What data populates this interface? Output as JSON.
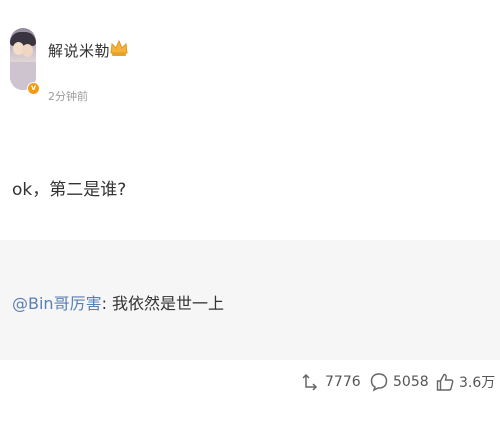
{
  "post": {
    "author": "解说米勒",
    "timestamp": "2分钟前",
    "vip_badge": "v",
    "text": "ok，第二是谁?"
  },
  "repost": {
    "mention": "@Bin哥厉害",
    "content": ": 我依然是世一上"
  },
  "actions": {
    "reposts": "7776",
    "comments": "5058",
    "likes": "3.6万"
  },
  "colors": {
    "mention": "#5b7fb3",
    "vip_badge": "#f49b13",
    "repost_background": "#f6f6f6"
  },
  "icons": [
    "crown-icon",
    "repost-icon",
    "comment-icon",
    "like-icon"
  ]
}
